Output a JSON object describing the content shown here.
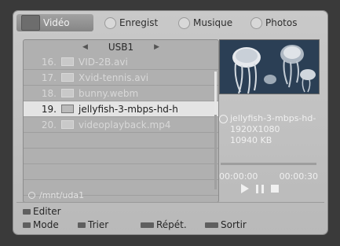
{
  "tabs": [
    {
      "label": "Vidéo",
      "icon": "film-icon",
      "active": true
    },
    {
      "label": "Enregist",
      "icon": "record-icon",
      "active": false
    },
    {
      "label": "Musique",
      "icon": "music-icon",
      "active": false
    },
    {
      "label": "Photos",
      "icon": "photo-icon",
      "active": false
    }
  ],
  "browser": {
    "device": "USB1",
    "files": [
      {
        "num": "16.",
        "name": "VID-2B.avi"
      },
      {
        "num": "17.",
        "name": "Xvid-tennis.avi"
      },
      {
        "num": "18.",
        "name": "bunny.webm"
      },
      {
        "num": "19.",
        "name": "jellyfish-3-mbps-hd-h"
      },
      {
        "num": "20.",
        "name": "videoplayback.mp4"
      }
    ],
    "path": "/mnt/uda1"
  },
  "info": {
    "filename": "jellyfish-3-mbps-hd-",
    "resolution": "1920X1080",
    "size": "10940 KB"
  },
  "player": {
    "current_time": "00:00:00",
    "total_time": "00:00:30",
    "progress": 0
  },
  "footer": {
    "edit": "Editer",
    "mode": "Mode",
    "sort": "Trier",
    "repeat": "Répét.",
    "exit": "Sortir"
  }
}
